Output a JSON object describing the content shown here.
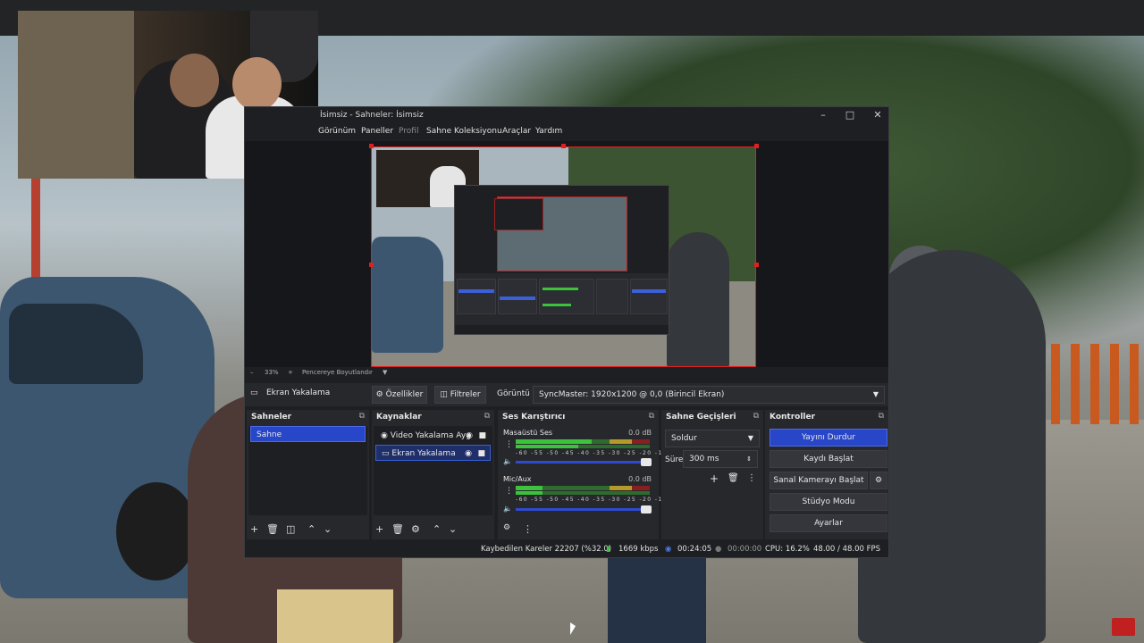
{
  "window": {
    "title": "İsimsiz - Sahneler: İsimsiz"
  },
  "menu": [
    "Görünüm",
    "Paneller",
    "Profil",
    "Sahne Koleksiyonu",
    "Araçlar",
    "Yardım"
  ],
  "zoom": {
    "percent": "33%",
    "fit_label": "Pencereye Boyutlandır"
  },
  "source_toolbar": {
    "selected_source": "Ekran Yakalama",
    "properties_label": "Özellikler",
    "filters_label": "Filtreler",
    "display_label": "Görüntü",
    "display_value": "SyncMaster: 1920x1200 @ 0,0 (Birincil Ekran)"
  },
  "scenes": {
    "title": "Sahneler",
    "items": [
      "Sahne"
    ]
  },
  "sources": {
    "title": "Kaynaklar",
    "items": [
      "Video Yakalama Ayg",
      "Ekran Yakalama"
    ]
  },
  "mixer": {
    "title": "Ses Karıştırıcı",
    "channels": [
      {
        "name": "Masaüstü Ses",
        "db": "0.0 dB"
      },
      {
        "name": "Mic/Aux",
        "db": "0.0 dB"
      }
    ],
    "scale": "-60 -55 -50 -45 -40 -35 -30 -25 -20 -15 -10 -5 0"
  },
  "transitions": {
    "title": "Sahne Geçişleri",
    "type": "Soldur",
    "duration_label": "Süre",
    "duration_value": "300 ms"
  },
  "controls": {
    "title": "Kontroller",
    "stop_stream": "Yayını Durdur",
    "start_record": "Kaydı Başlat",
    "start_virtual_cam": "Sanal Kamerayı Başlat",
    "studio_mode": "Stüdyo Modu",
    "settings": "Ayarlar"
  },
  "status": {
    "dropped_frames": "Kaybedilen Kareler 22207 (%32.0)",
    "bitrate": "1669 kbps",
    "stream_time": "00:24:05",
    "record_time": "00:00:00",
    "cpu": "CPU: 16.2%",
    "fps": "48.00 / 48.00 FPS"
  },
  "colors": {
    "accent": "#2846c8",
    "live": "#3cc33c",
    "selection_border": "#e02020"
  }
}
